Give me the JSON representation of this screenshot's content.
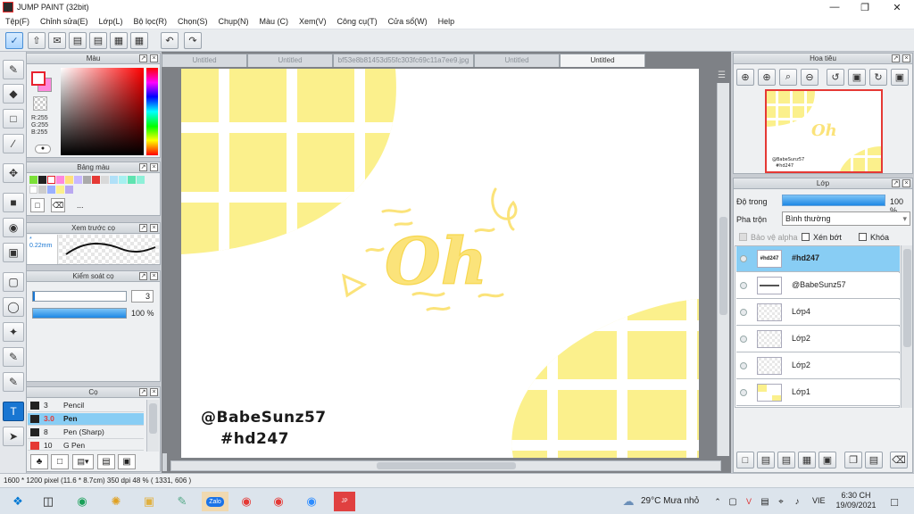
{
  "window": {
    "title": "JUMP PAINT (32bit)"
  },
  "menu": [
    "Tệp(F)",
    "Chỉnh sửa(E)",
    "Lớp(L)",
    "Bộ lọc(R)",
    "Chọn(S)",
    "Chụp(N)",
    "Màu (C)",
    "Xem(V)",
    "Công cụ(T)",
    "Cửa sổ(W)",
    "Help"
  ],
  "tabs": [
    "Untitled",
    "Untitled",
    "bf53e8b81453d55fc303fc69c11a7ee9.jpg",
    "Untitled",
    "Untitled"
  ],
  "color_panel": {
    "title": "Màu",
    "r": "R:255",
    "g": "G:255",
    "b": "B:255"
  },
  "palette_panel": {
    "title": "Bảng màu",
    "more": "..."
  },
  "brush_preview_panel": {
    "title": "Xem trước cọ",
    "size": "* 0.22mm"
  },
  "brush_control_panel": {
    "title": "Kiểm soát cọ",
    "size_value": "3",
    "opacity_value": "100 %"
  },
  "brush_panel": {
    "title": "Cọ",
    "items": [
      {
        "size": "3",
        "name": "Pencil",
        "color": "#222222"
      },
      {
        "size": "3.0",
        "name": "Pen",
        "color": "#222222"
      },
      {
        "size": "8",
        "name": "Pen (Sharp)",
        "color": "#222222"
      },
      {
        "size": "10",
        "name": "G Pen",
        "color": "#e53935"
      }
    ]
  },
  "navigator_panel": {
    "title": "Hoa tiêu"
  },
  "layer_panel": {
    "title": "Lớp",
    "opacity_label": "Độ trong",
    "opacity_value": "100 %",
    "blend_label": "Pha trộn",
    "blend_value": "Bình thường",
    "alpha_label": "Bảo vệ alpha",
    "clip_label": "Xén bớt",
    "lock_label": "Khóa",
    "layers": [
      {
        "name": "#hd247",
        "thumb_text": "#hd247"
      },
      {
        "name": "@BabeSunz57",
        "thumb_text": ""
      },
      {
        "name": "Lớp4",
        "thumb_text": ""
      },
      {
        "name": "Lớp2",
        "thumb_text": ""
      },
      {
        "name": "Lớp2",
        "thumb_text": ""
      },
      {
        "name": "Lớp1",
        "thumb_text": ""
      }
    ]
  },
  "canvas_text": {
    "word": "Oh",
    "sig1": "@BabeSunz57",
    "sig2": "#hd247"
  },
  "status": "1600 * 1200 pixel  (11.6 * 8.7cm)  350 dpi  48 %  ( 1331, 606 )",
  "taskbar": {
    "weather": "29°C  Mưa nhỏ",
    "lang": "VIE",
    "time": "6:30 CH",
    "date": "19/09/2021"
  },
  "colors": {
    "yellow": "#fbf08c",
    "accent": "#1976d2",
    "selection": "#88cdf4",
    "foreground": "#e8222f",
    "background_swatch": "#ff88dd"
  }
}
